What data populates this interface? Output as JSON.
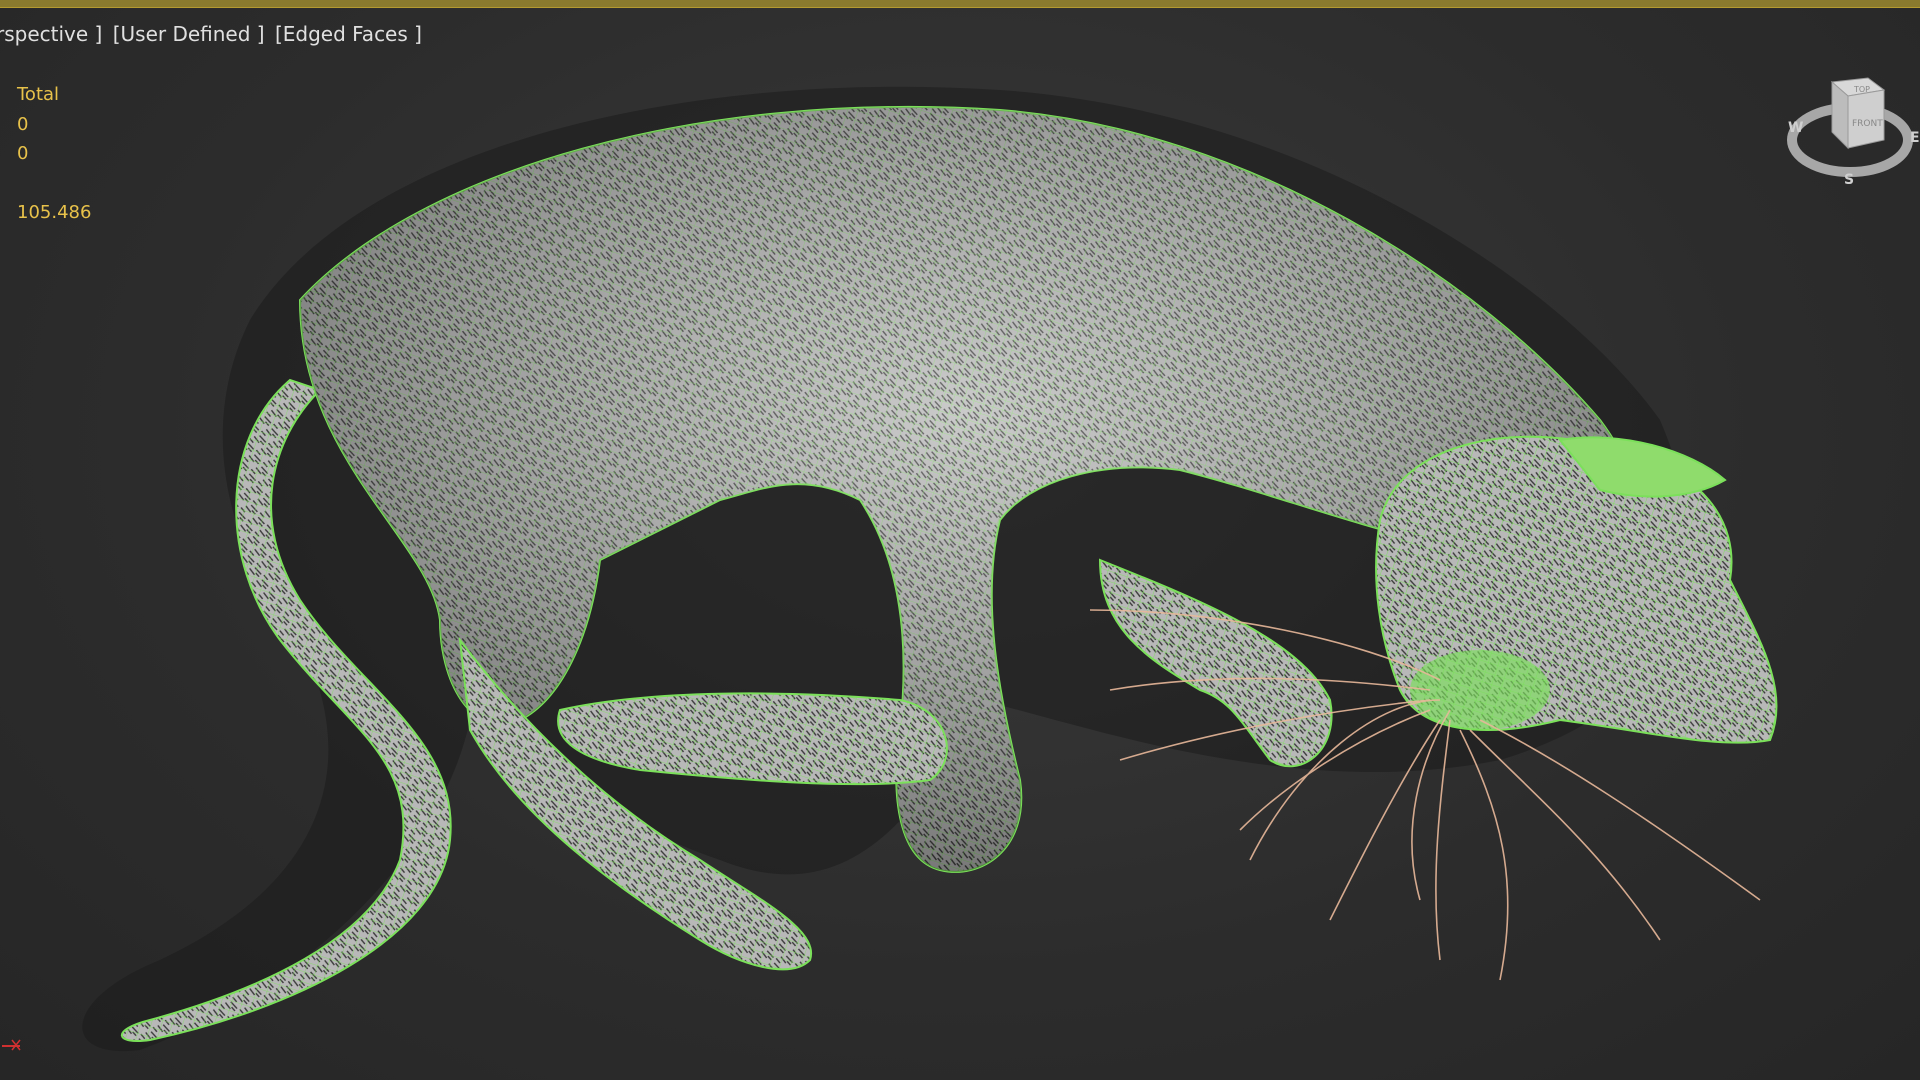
{
  "viewport": {
    "label_segments": [
      "rspective ]",
      "[User Defined ]",
      "[Edged Faces ]"
    ],
    "stats": {
      "header": "Total",
      "line1": "0",
      "line2": "0",
      "fps": "105.486"
    }
  },
  "viewcube": {
    "face_top": "TOP",
    "face_front": "FRONT",
    "compass_w": "W",
    "compass_e": "E",
    "compass_s": "S"
  },
  "colors": {
    "background": "#2f2f2f",
    "wireframe": "#7be05a",
    "fur_body": "#bdbdbd",
    "whiskers": "#e8b89a",
    "stats_text": "#e8c24a",
    "label_text": "#e0e0e0"
  },
  "icons": [
    "viewcube-icon",
    "axis-tripod-icon"
  ]
}
